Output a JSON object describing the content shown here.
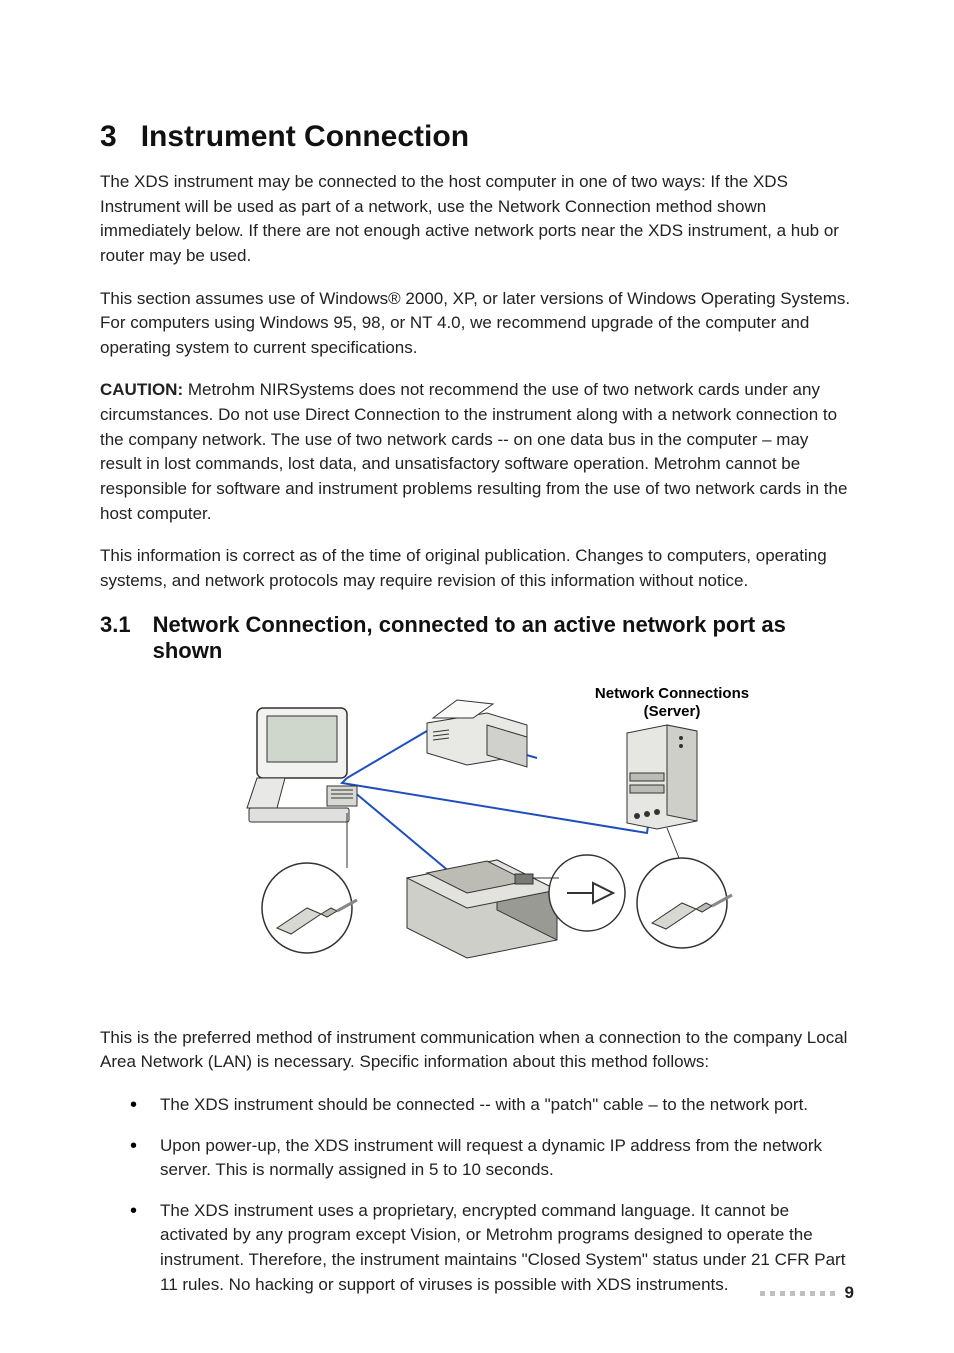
{
  "heading": {
    "number": "3",
    "title": "Instrument Connection"
  },
  "paragraphs": {
    "p1": "The XDS instrument may be connected to the host computer in one of two ways: If the XDS Instrument will be used as part of a network, use the Network Connection method shown immediately below. If there are not enough active network ports near the XDS instrument, a hub or router may be used.",
    "p2": "This section assumes use of Windows® 2000, XP, or later versions of Windows Operating Systems. For computers using Windows 95, 98, or NT 4.0, we recommend upgrade of the computer and operating system to current specifications.",
    "p3_label": "CAUTION:",
    "p3_rest": " Metrohm NIRSystems does not recommend the use of two network cards under any circumstances. Do not use Direct Connection to the instrument along with a network connection to the company network. The use of two network cards -- on one data bus in the computer – may result in lost commands, lost data, and unsatisfactory software operation. Metrohm cannot be responsible for software and instrument problems resulting from the use of two network cards in the host computer.",
    "p4": "This information is correct as of the time of original publication. Changes to computers, operating systems, and network protocols may require revision of this information without notice."
  },
  "subheading": {
    "number": "3.1",
    "title": "Network Connection, connected to an active network port as shown"
  },
  "figure": {
    "label_line1": "Network Connections",
    "label_line2": "(Server)"
  },
  "after_figure": {
    "intro": "This is the preferred method of instrument communication when a connection to the company Local Area Network (LAN) is necessary. Specific information about this method follows:",
    "bullets": [
      "The XDS instrument should be connected -- with a \"patch\" cable – to the network port.",
      "Upon power-up, the XDS instrument will request a dynamic IP address from the network server. This is normally assigned in 5 to 10 seconds.",
      "The XDS instrument uses a proprietary, encrypted command language. It cannot be activated by any program except Vision, or Metrohm programs designed to operate the instrument. Therefore, the instrument maintains \"Closed System\" status under 21 CFR Part 11 rules. No hacking or support of viruses is possible with XDS instruments."
    ]
  },
  "page_number": "9"
}
